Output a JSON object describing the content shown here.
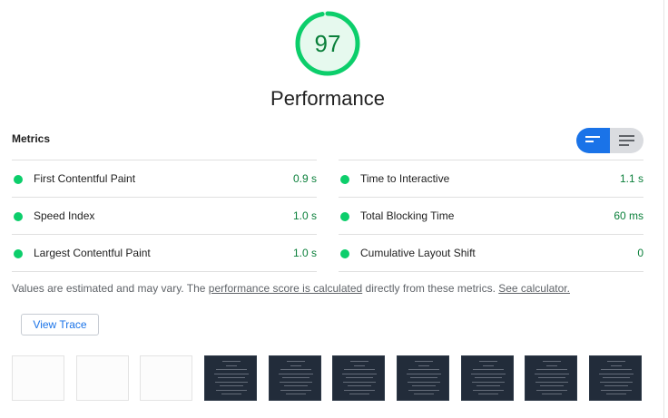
{
  "score": {
    "value": "97",
    "fraction": 0.97,
    "color": "#0cce6b"
  },
  "category_title": "Performance",
  "metrics_heading": "Metrics",
  "view_toggle": {
    "options": [
      "collapsed-view-icon",
      "expanded-view-icon"
    ],
    "selected": "collapsed-view-icon",
    "accent": "#1a73e8"
  },
  "metrics": [
    {
      "label": "First Contentful Paint",
      "value": "0.9 s",
      "status": "pass"
    },
    {
      "label": "Time to Interactive",
      "value": "1.1 s",
      "status": "pass"
    },
    {
      "label": "Speed Index",
      "value": "1.0 s",
      "status": "pass"
    },
    {
      "label": "Total Blocking Time",
      "value": "60 ms",
      "status": "pass"
    },
    {
      "label": "Largest Contentful Paint",
      "value": "1.0 s",
      "status": "pass"
    },
    {
      "label": "Cumulative Layout Shift",
      "value": "0",
      "status": "pass"
    }
  ],
  "note": {
    "prefix": "Values are estimated and may vary. The ",
    "link1": "performance score is calculated",
    "middle": " directly from these metrics. ",
    "link2": "See calculator."
  },
  "view_trace_label": "View Trace",
  "filmstrip": {
    "frames": [
      "blank",
      "blank",
      "blank",
      "page",
      "page",
      "page",
      "page",
      "page",
      "page",
      "page"
    ]
  },
  "colors": {
    "pass": "#0cce6b",
    "pass_text": "#0a7f3a",
    "link": "#1a73e8"
  }
}
